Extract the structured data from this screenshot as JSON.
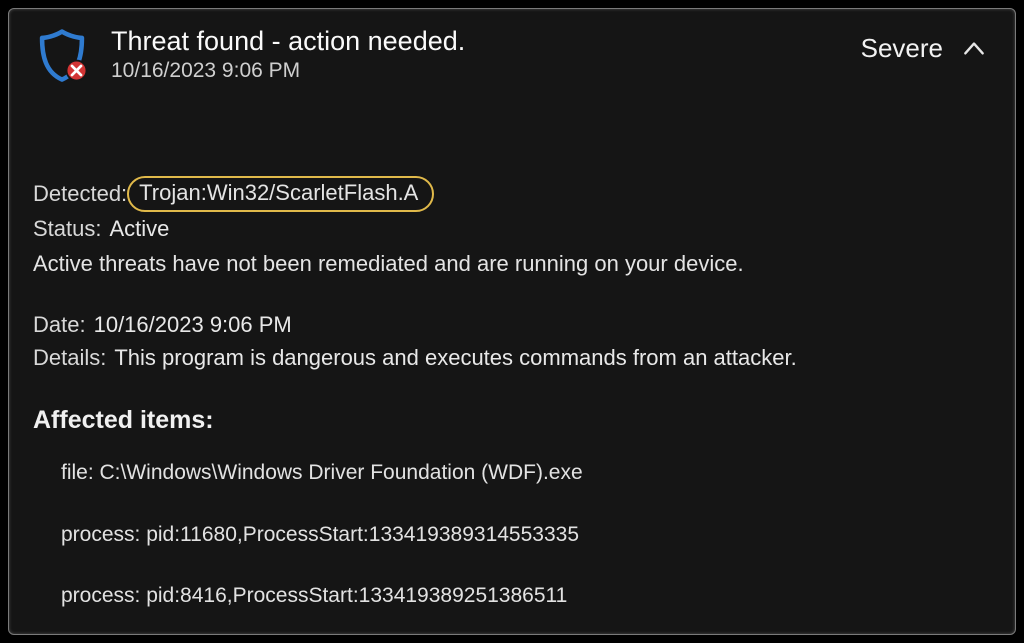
{
  "header": {
    "title": "Threat found - action needed.",
    "timestamp": "10/16/2023 9:06 PM",
    "severity": "Severe"
  },
  "detected": {
    "label": "Detected:",
    "value": "Trojan:Win32/ScarletFlash.A"
  },
  "status": {
    "label": "Status:",
    "value": "Active"
  },
  "status_desc": "Active threats have not been remediated and are running on your device.",
  "date": {
    "label": "Date:",
    "value": "10/16/2023 9:06 PM"
  },
  "details": {
    "label": "Details:",
    "value": "This program is dangerous and executes commands from an attacker."
  },
  "affected": {
    "title": "Affected items:",
    "items": [
      "file: C:\\Windows\\Windows Driver Foundation (WDF).exe",
      "process: pid:11680,ProcessStart:133419389314553335",
      "process: pid:8416,ProcessStart:133419389251386511"
    ]
  }
}
